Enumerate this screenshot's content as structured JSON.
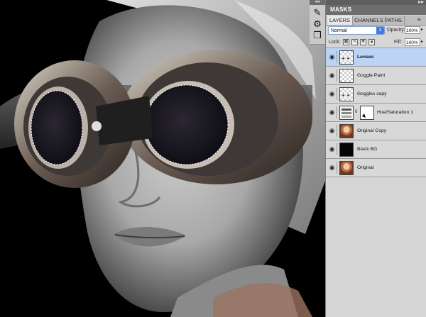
{
  "dock": {
    "collapse_glyph": "◂◂",
    "panel_collapse_glyph": "▸▸",
    "tools": [
      "brush-with-dots-icon",
      "adjustments-icon",
      "clone-icon"
    ],
    "masks_panel_title": "MASKS"
  },
  "layers_panel": {
    "tabs": [
      {
        "label": "LAYERS",
        "active": true
      },
      {
        "label": "CHANNELS",
        "active": false
      },
      {
        "label": "PATHS",
        "active": false
      }
    ],
    "blend_mode": "Normal",
    "opacity_label": "Opacity:",
    "opacity_value": "100%",
    "lock_label": "Lock:",
    "fill_label": "Fill:",
    "fill_value": "100%",
    "layers": [
      {
        "name": "Lenses",
        "thumb": "transparent-dots",
        "selected": true
      },
      {
        "name": "Goggle Paint",
        "thumb": "transparent",
        "selected": false
      },
      {
        "name": "Goggles copy",
        "thumb": "transparent-dots",
        "selected": false
      },
      {
        "name": "Hue/Saturation 1",
        "thumb": "adjustment",
        "selected": false
      },
      {
        "name": "Original Copy",
        "thumb": "photo",
        "selected": false
      },
      {
        "name": "Black BG",
        "thumb": "black",
        "selected": false
      },
      {
        "name": "Original",
        "thumb": "photo",
        "selected": false
      }
    ]
  },
  "colors": {
    "selection_highlight": "#bcd3f5",
    "panel_bg": "#d6d6d6",
    "canvas_bg": "#000000"
  }
}
